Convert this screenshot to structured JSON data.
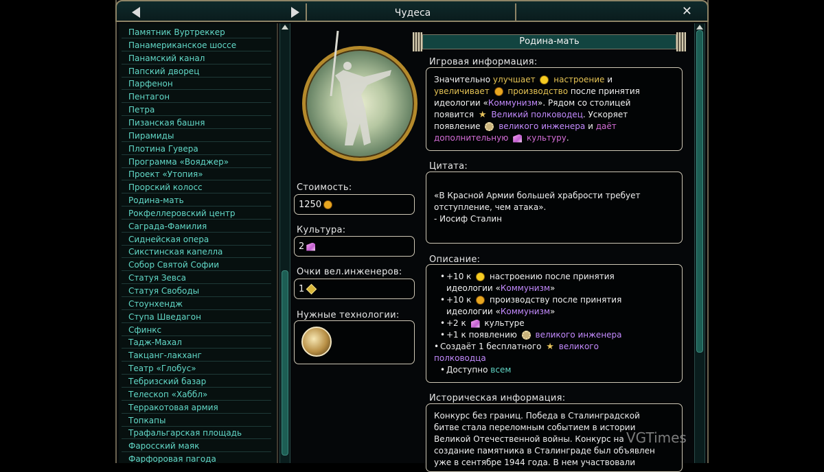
{
  "window": {
    "title": "Чудеса"
  },
  "wonders_list": [
    "Памятник Вуртреккер",
    "Панамериканское шоссе",
    "Панамский канал",
    "Папский дворец",
    "Парфенон",
    "Пентагон",
    "Петра",
    "Пизанская башня",
    "Пирамиды",
    "Плотина Гувера",
    "Программа «Вояджер»",
    "Проект «Утопия»",
    "Прорский колосс",
    "Родина-мать",
    "Рокфеллеровский центр",
    "Саграда-Фамилия",
    "Сиднейская опера",
    "Сикстинская капелла",
    "Собор Святой Софии",
    "Статуя Зевса",
    "Статуя Свободы",
    "Стоунхендж",
    "Ступа Шведагон",
    "Сфинкс",
    "Тадж-Махал",
    "Такцанг-лакханг",
    "Театр «Глобус»",
    "Тебризский базар",
    "Телескоп «Хаббл»",
    "Терракотовая армия",
    "Топкапы",
    "Трафальгарская площадь",
    "Фаросский маяк",
    "Фарфоровая пагода"
  ],
  "wonder": {
    "name": "Родина-мать",
    "cost_label": "Стоимость:",
    "cost_value": "1250",
    "culture_label": "Культура:",
    "culture_value": "2",
    "engineer_label": "Очки вел.инженеров:",
    "engineer_value": "1",
    "tech_label": "Нужные технологии:",
    "game_info_label": "Игровая информация:",
    "game_info": {
      "l1a": "Значительно",
      "l1b": "улучшает",
      "l1c": "настроение",
      "l1d": "и",
      "l2a": "увеличивает",
      "l2b": "производство",
      "l2c": "после принятия",
      "l3a": "идеологии «",
      "l3b": "Коммунизм",
      "l3c": "». Рядом со столицей",
      "l4a": "появится",
      "l4b": "Великий полководец",
      "l4c": ". Ускоряет",
      "l5a": "появление",
      "l5b": "великого инженера",
      "l5c": "и",
      "l5d": "даёт",
      "l6a": "дополнительную",
      "l6b": "культуру",
      "l6c": "."
    },
    "quote_label": "Цитата:",
    "quote": {
      "l1": "«В Красной Армии большей храбрости требует",
      "l2": "отступление, чем атака».",
      "l3": " - Иосиф Сталин"
    },
    "desc_label": "Описание:",
    "desc": {
      "b1a": "+10 к",
      "b1b": "настроению после принятия",
      "b1c": "идеологии «",
      "b1d": "Коммунизм",
      "b1e": "»",
      "b2a": "+10 к",
      "b2b": "производству после принятия",
      "b2c": "идеологии «",
      "b2d": "Коммунизм",
      "b2e": "»",
      "b3a": "+2 к",
      "b3b": "культуре",
      "b4a": "+1 к появлению",
      "b4b": "великого инженера",
      "b5a": "Создаёт 1 бесплатного",
      "b5b": "великого",
      "b5c": "полководца",
      "b6a": "Доступно",
      "b6b": "всем"
    },
    "history_label": "Историческая информация:",
    "history": {
      "l1": "Конкурс без границ. Победа в Сталинградской",
      "l2": "битве стала переломным событием в истории",
      "l3": "Великой Отечественной войны. Конкурс на",
      "l4": "создание памятника в Сталинграде был объявлен",
      "l5": "уже в сентябре 1944 года. В нем участвовали"
    }
  },
  "watermark": "VGTimes",
  "icons": {
    "arrow_left": "arrow-left-icon",
    "arrow_right": "arrow-right-icon",
    "close": "close-icon",
    "production": "production-icon",
    "happiness": "happiness-icon",
    "culture": "culture-icon",
    "great_general": "great-general-icon",
    "great_engineer": "great-engineer-icon",
    "engineer_points": "engineer-points-icon"
  },
  "colors": {
    "frame_gold": "#8f8567",
    "list_text": "#62d9c8",
    "yellow_link": "#e5c354",
    "purple_link": "#c48bff",
    "magenta_link": "#d56ed8",
    "cyan_link": "#61d4c4"
  }
}
